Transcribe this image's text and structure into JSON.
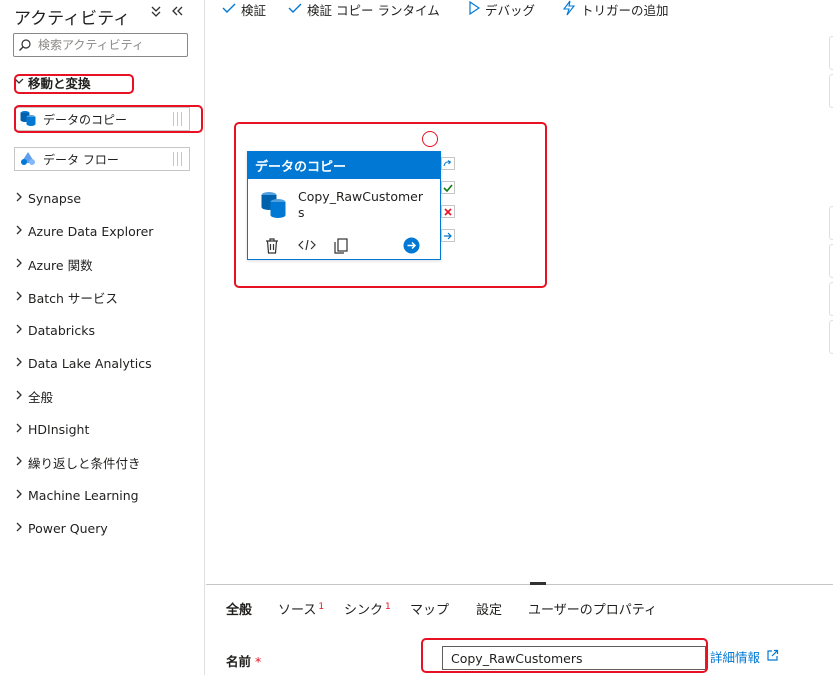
{
  "sidebar": {
    "title": "アクティビティ",
    "search_placeholder": "検索アクティビティ",
    "move_transform_label": "移動と変換",
    "copy_data_label": "データのコピー",
    "data_flow_label": "データ フロー",
    "categories": [
      "Synapse",
      "Azure Data Explorer",
      "Azure 関数",
      "Batch サービス",
      "Databricks",
      "Data Lake Analytics",
      "全般",
      "HDInsight",
      "繰り返しと条件付き",
      "Machine Learning",
      "Power Query"
    ]
  },
  "toolbar": {
    "validate": "検証",
    "validate_copy_runtime": "検証 コピー ランタイム",
    "debug": "デバッグ",
    "add_trigger": "トリガーの追加"
  },
  "canvas": {
    "card_title": "データのコピー",
    "card_name": "Copy_RawCustomers"
  },
  "properties": {
    "tabs": {
      "general": "全般",
      "source": "ソース",
      "source_badge": "1",
      "sink": "シンク",
      "sink_badge": "1",
      "mapping": "マップ",
      "settings": "設定",
      "user_properties": "ユーザーのプロパティ"
    },
    "name_label": "名前",
    "required_mark": "*",
    "name_value": "Copy_RawCustomers",
    "more_info": "詳細情報"
  },
  "colors": {
    "accent": "#0078d4",
    "highlight": "#e81123"
  }
}
